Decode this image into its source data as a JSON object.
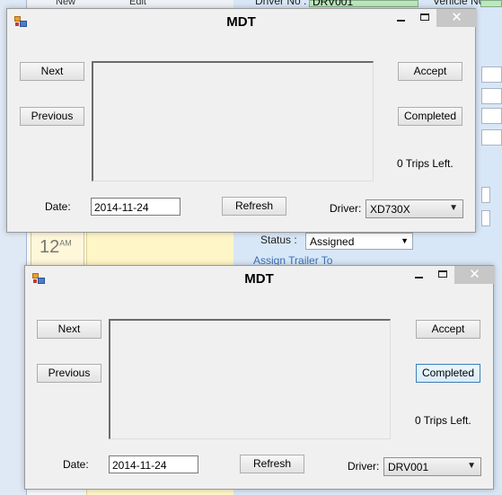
{
  "background_app": {
    "toolbar": {
      "new_label": "New",
      "edit_label": "Edit"
    },
    "time_label": "12",
    "time_suffix": "AM",
    "driver_no_label": "Driver No :",
    "driver_no_value": "DRV001",
    "vehicle_no_label": "Vehicle No :",
    "status_label": "Status :",
    "status_value": "Assigned",
    "assign_trailer_link": "Assign Trailer To"
  },
  "windows": [
    {
      "title": "MDT",
      "next_label": "Next",
      "previous_label": "Previous",
      "accept_label": "Accept",
      "completed_label": "Completed",
      "trips_left": "0 Trips Left.",
      "date_label": "Date:",
      "date_value": "2014-11-24",
      "refresh_label": "Refresh",
      "driver_label": "Driver:",
      "driver_value": "XD730X",
      "close_glyph": "✕"
    },
    {
      "title": "MDT",
      "next_label": "Next",
      "previous_label": "Previous",
      "accept_label": "Accept",
      "completed_label": "Completed",
      "trips_left": "0 Trips Left.",
      "date_label": "Date:",
      "date_value": "2014-11-24",
      "refresh_label": "Refresh",
      "driver_label": "Driver:",
      "driver_value": "DRV001",
      "close_glyph": "✕"
    }
  ],
  "icons": {
    "app": "mdt-app-icon",
    "minimize": "minimize-icon",
    "maximize": "maximize-icon",
    "close": "close-icon",
    "dropdown": "chevron-down-icon"
  },
  "colors": {
    "window_bg": "#f0f0f0",
    "close_button": "#c7c7c7",
    "focus_border": "#3c7fb1",
    "background_panel": "#d8e7f7"
  }
}
